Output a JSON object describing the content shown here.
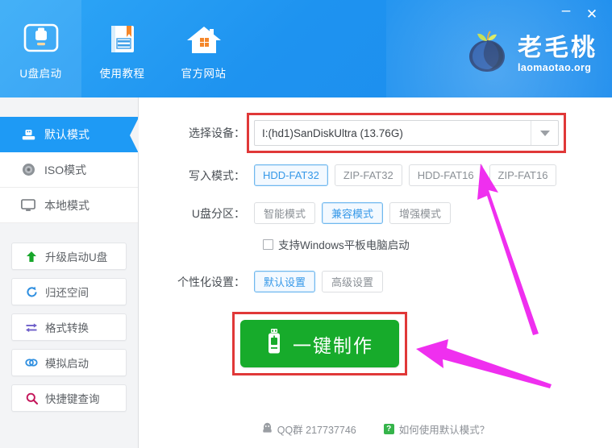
{
  "window": {
    "minimize_label": "–",
    "close_label": "✕"
  },
  "header": {
    "tabs": [
      {
        "label": "U盘启动",
        "icon": "usb-boot-icon",
        "active": true
      },
      {
        "label": "使用教程",
        "icon": "tutorial-book-icon",
        "active": false
      },
      {
        "label": "官方网站",
        "icon": "home-icon",
        "active": false
      }
    ],
    "logo": {
      "icon": "peach-logo-icon",
      "name_cn": "老毛桃",
      "url": "laomaotao.org"
    }
  },
  "sidebar": {
    "modes": [
      {
        "label": "默认模式",
        "icon": "usb-device-icon",
        "active": true
      },
      {
        "label": "ISO模式",
        "icon": "disc-icon",
        "active": false
      },
      {
        "label": "本地模式",
        "icon": "monitor-icon",
        "active": false
      }
    ],
    "tools": [
      {
        "label": "升级启动U盘",
        "icon": "up-arrow-icon",
        "color": "#17a62a"
      },
      {
        "label": "归还空间",
        "icon": "refresh-icon",
        "color": "#2f8fe0"
      },
      {
        "label": "格式转换",
        "icon": "transfer-icon",
        "color": "#6e5fc9"
      },
      {
        "label": "模拟启动",
        "icon": "link-icon",
        "color": "#2f8fe0"
      },
      {
        "label": "快捷键查询",
        "icon": "search-icon",
        "color": "#c4165a"
      }
    ]
  },
  "main": {
    "device_row": {
      "label": "选择设备：",
      "value": "I:(hd1)SanDiskUltra (13.76G)",
      "placeholder": "选择设备",
      "highlight_color": "#e03838"
    },
    "write_row": {
      "label": "写入模式：",
      "options": [
        {
          "label": "HDD-FAT32",
          "selected": true
        },
        {
          "label": "ZIP-FAT32",
          "selected": false
        },
        {
          "label": "HDD-FAT16",
          "selected": false
        },
        {
          "label": "ZIP-FAT16",
          "selected": false
        }
      ]
    },
    "partition_row": {
      "label": "U盘分区：",
      "options": [
        {
          "label": "智能模式",
          "selected": false
        },
        {
          "label": "兼容模式",
          "selected": true
        },
        {
          "label": "增强模式",
          "selected": false
        }
      ]
    },
    "tablet_checkbox": {
      "label": "支持Windows平板电脑启动",
      "checked": false
    },
    "personalize_row": {
      "label": "个性化设置：",
      "options": [
        {
          "label": "默认设置",
          "selected": true
        },
        {
          "label": "高级设置",
          "selected": false
        }
      ]
    },
    "make_button": {
      "label": "一键制作",
      "icon": "usb-stick-icon",
      "color": "#17ab2b",
      "highlight_color": "#e03838"
    }
  },
  "footer": {
    "items": [
      {
        "label": "QQ群 217737746",
        "icon": "qq-penguin-icon"
      },
      {
        "label": "如何使用默认模式？",
        "icon": "question-badge-icon"
      }
    ]
  },
  "annotations": {
    "arrow_color": "#ef2fef",
    "arrows": [
      {
        "name": "arrow-to-device-dropdown"
      },
      {
        "name": "arrow-to-make-button"
      }
    ]
  }
}
